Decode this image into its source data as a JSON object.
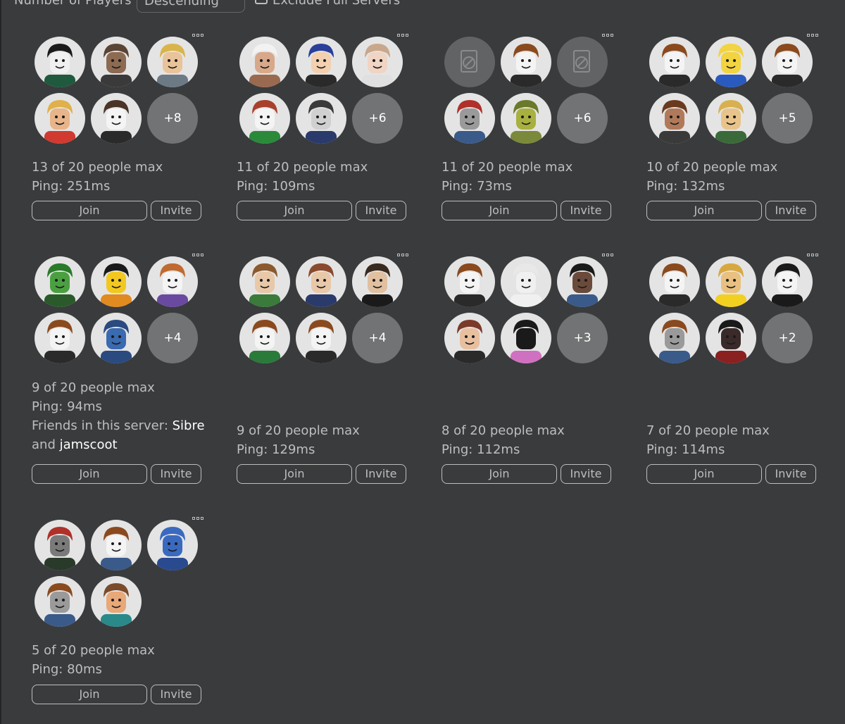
{
  "filters": {
    "sort_label": "Number of Players",
    "sort_value": "Descending",
    "exclude_full_label": "Exclude Full Servers",
    "exclude_full_checked": false
  },
  "buttons": {
    "join_label": "Join",
    "invite_label": "Invite"
  },
  "servers": [
    {
      "players_text": "13 of 20 people max",
      "ping_text": "Ping: 251ms",
      "avatars": [
        {
          "kind": "avatar",
          "icon": "avatar-black-hair-icon",
          "skin": "#f0f0f0",
          "hair": "#1a1a1a",
          "body": "#1f5a3e"
        },
        {
          "kind": "avatar",
          "icon": "avatar-bun-hair-icon",
          "skin": "#8d6a52",
          "hair": "#5a4436",
          "body": "#3a3a3a"
        },
        {
          "kind": "avatar",
          "icon": "avatar-blonde-sunglasses-icon",
          "skin": "#e9c39a",
          "hair": "#d9b44a",
          "body": "#6c7a86"
        }
      ],
      "avatars_row2": [
        {
          "kind": "avatar",
          "icon": "avatar-blonde-red-shirt-icon",
          "skin": "#e8b48a",
          "hair": "#e0b04a",
          "body": "#d03a30"
        },
        {
          "kind": "avatar",
          "icon": "avatar-smile-brown-hair-icon",
          "skin": "#f4f4f4",
          "hair": "#4a3428",
          "body": "#2a2a2a"
        }
      ],
      "overflow": "+8"
    },
    {
      "players_text": "11 of 20 people max",
      "ping_text": "Ping: 109ms",
      "avatars": [
        {
          "kind": "avatar",
          "icon": "avatar-white-cap-icon",
          "skin": "#d8a88a",
          "hair": "#f2f2f2",
          "body": "#9a6a50"
        },
        {
          "kind": "avatar",
          "icon": "avatar-blue-hair-icon",
          "skin": "#f2d0b0",
          "hair": "#2a3f9a",
          "body": "#2a2a2a"
        },
        {
          "kind": "avatar",
          "icon": "avatar-long-light-hair-icon",
          "skin": "#f0d4c4",
          "hair": "#c9a78a",
          "body": "#e0e0e0"
        }
      ],
      "avatars_row2": [
        {
          "kind": "avatar",
          "icon": "avatar-red-hair-icon",
          "skin": "#f4f4f4",
          "hair": "#a8402c",
          "body": "#2a8a3a"
        },
        {
          "kind": "avatar",
          "icon": "avatar-small-figure-icon",
          "skin": "#d0d0d0",
          "hair": "#3a3a3a",
          "body": "#2a3a6a"
        }
      ],
      "overflow": "+6"
    },
    {
      "players_text": "11 of 20 people max",
      "ping_text": "Ping: 73ms",
      "avatars": [
        {
          "kind": "blocked",
          "icon": "unavailable-avatar-icon"
        },
        {
          "kind": "avatar",
          "icon": "avatar-classic-brown-hair-icon",
          "skin": "#f4f4f4",
          "hair": "#8a4a1e",
          "body": "#2a2a2a"
        },
        {
          "kind": "blocked",
          "icon": "unavailable-avatar-icon"
        }
      ],
      "avatars_row2": [
        {
          "kind": "avatar",
          "icon": "avatar-red-cap-icon",
          "skin": "#9a9a9a",
          "hair": "#b0302a",
          "body": "#3a5a8a"
        },
        {
          "kind": "avatar",
          "icon": "avatar-green-creature-icon",
          "skin": "#a8b040",
          "hair": "#6a7a2a",
          "body": "#7a8a3a"
        }
      ],
      "overflow": "+6"
    },
    {
      "players_text": "10 of 20 people max",
      "ping_text": "Ping: 132ms",
      "avatars": [
        {
          "kind": "avatar",
          "icon": "avatar-classic-brown-hair-icon",
          "skin": "#f4f4f4",
          "hair": "#8a4a1e",
          "body": "#2a2a2a"
        },
        {
          "kind": "avatar",
          "icon": "avatar-yellow-noob-icon",
          "skin": "#f2d340",
          "hair": "#f2d340",
          "body": "#2a5ac0"
        },
        {
          "kind": "avatar",
          "icon": "avatar-classic-brown-hair-icon",
          "skin": "#f4f4f4",
          "hair": "#8a4a1e",
          "body": "#2a2a2a"
        }
      ],
      "avatars_row2": [
        {
          "kind": "avatar",
          "icon": "avatar-purple-sunglasses-icon",
          "skin": "#b07a5a",
          "hair": "#6a3a1e",
          "body": "#3a3a3a"
        },
        {
          "kind": "avatar",
          "icon": "avatar-blonde-green-shirt-icon",
          "skin": "#e8c48a",
          "hair": "#d8b050",
          "body": "#3a6a3a"
        }
      ],
      "overflow": "+5"
    },
    {
      "players_text": "9 of 20 people max",
      "ping_text": "Ping: 94ms",
      "friends_prefix": "Friends in this server:",
      "friend_1": "Sibre",
      "friends_and": "and",
      "friend_2": "jamscoot",
      "avatars": [
        {
          "kind": "avatar",
          "icon": "avatar-green-helmet-icon",
          "skin": "#4aa040",
          "hair": "#2a7a2a",
          "body": "#2a5a2a"
        },
        {
          "kind": "avatar",
          "icon": "avatar-duck-top-hat-icon",
          "skin": "#f2c820",
          "hair": "#1a1a1a",
          "body": "#e08a20"
        },
        {
          "kind": "avatar",
          "icon": "avatar-cowboy-hat-icon",
          "skin": "#f4f4f4",
          "hair": "#c06a30",
          "body": "#6a4aa0"
        }
      ],
      "avatars_row2": [
        {
          "kind": "avatar",
          "icon": "avatar-classic-brown-hair-icon",
          "skin": "#f4f4f4",
          "hair": "#8a4a1e",
          "body": "#2a2a2a"
        },
        {
          "kind": "avatar",
          "icon": "avatar-blue-face-icon",
          "skin": "#3a6ab0",
          "hair": "#2a4a80",
          "body": "#2a4a80"
        }
      ],
      "overflow": "+4"
    },
    {
      "players_text": "9 of 20 people max",
      "ping_text": "Ping: 129ms",
      "avatars": [
        {
          "kind": "avatar",
          "icon": "avatar-sunglasses-brown-hair-icon",
          "skin": "#e8c8a8",
          "hair": "#8a5a2e",
          "body": "#3a7a3a"
        },
        {
          "kind": "avatar",
          "icon": "avatar-glasses-brown-hair-icon",
          "skin": "#e8c8a8",
          "hair": "#8a4a2e",
          "body": "#2a3a6a"
        },
        {
          "kind": "avatar",
          "icon": "avatar-small-figure-icon",
          "skin": "#e0c0a0",
          "hair": "#3a2a1e",
          "body": "#1a1a1a"
        }
      ],
      "avatars_row2": [
        {
          "kind": "avatar",
          "icon": "avatar-classic-brown-hair-icon",
          "skin": "#f4f4f4",
          "hair": "#8a4a1e",
          "body": "#2a7a3a"
        },
        {
          "kind": "avatar",
          "icon": "avatar-classic-brown-hair-icon",
          "skin": "#f4f4f4",
          "hair": "#8a4a1e",
          "body": "#2a2a2a"
        }
      ],
      "overflow": "+4"
    },
    {
      "players_text": "8 of 20 people max",
      "ping_text": "Ping: 112ms",
      "avatars": [
        {
          "kind": "avatar",
          "icon": "avatar-classic-brown-hair-icon",
          "skin": "#f4f4f4",
          "hair": "#8a4a1e",
          "body": "#2a2a2a"
        },
        {
          "kind": "avatar",
          "icon": "avatar-small-figure-icon",
          "skin": "#f0f0f0",
          "hair": "#e8e8e8",
          "body": "#f0f0f0"
        },
        {
          "kind": "avatar",
          "icon": "avatar-dark-skin-icon",
          "skin": "#6a4a3a",
          "hair": "#1a1a1a",
          "body": "#3a5a8a"
        }
      ],
      "avatars_row2": [
        {
          "kind": "avatar",
          "icon": "avatar-long-red-hair-icon",
          "skin": "#e8c0a0",
          "hair": "#7a3a2a",
          "body": "#2a2a2a"
        },
        {
          "kind": "avatar",
          "icon": "avatar-small-figure-icon",
          "skin": "#1a1a1a",
          "hair": "#1a1a1a",
          "body": "#d070c0"
        }
      ],
      "overflow": "+3"
    },
    {
      "players_text": "7 of 20 people max",
      "ping_text": "Ping: 114ms",
      "avatars": [
        {
          "kind": "avatar",
          "icon": "avatar-classic-brown-hair-icon",
          "skin": "#f4f4f4",
          "hair": "#8a4a1e",
          "body": "#2a2a2a"
        },
        {
          "kind": "avatar",
          "icon": "avatar-blonde-yellow-shirt-icon",
          "skin": "#e8c080",
          "hair": "#d8a840",
          "body": "#f2d020"
        },
        {
          "kind": "avatar",
          "icon": "avatar-headphones-icon",
          "skin": "#f4f4f4",
          "hair": "#1a1a1a",
          "body": "#1a1a1a"
        }
      ],
      "avatars_row2": [
        {
          "kind": "avatar",
          "icon": "avatar-classic-brown-hair-icon",
          "skin": "#9a9a9a",
          "hair": "#8a4a1e",
          "body": "#3a5a8a"
        },
        {
          "kind": "avatar",
          "icon": "avatar-long-black-hair-icon",
          "skin": "#3a2a2a",
          "hair": "#1a1a1a",
          "body": "#8a2020"
        }
      ],
      "overflow": "+2"
    },
    {
      "players_text": "5 of 20 people max",
      "ping_text": "Ping: 80ms",
      "avatars": [
        {
          "kind": "avatar",
          "icon": "avatar-red-cap-sunglasses-icon",
          "skin": "#7a7a7a",
          "hair": "#b0302a",
          "body": "#2a3a2a"
        },
        {
          "kind": "avatar",
          "icon": "avatar-classic-brown-hair-icon",
          "skin": "#f4f4f4",
          "hair": "#8a4a1e",
          "body": "#3a5a8a"
        },
        {
          "kind": "avatar",
          "icon": "avatar-blue-bald-icon",
          "skin": "#3a6ac0",
          "hair": "#3a6ac0",
          "body": "#2a4a90"
        }
      ],
      "avatars_row2": [
        {
          "kind": "avatar",
          "icon": "avatar-classic-brown-hair-icon",
          "skin": "#9a9a9a",
          "hair": "#8a4a1e",
          "body": "#3a5a8a"
        },
        {
          "kind": "avatar",
          "icon": "avatar-angry-face-icon",
          "skin": "#e8a878",
          "hair": "#7a4a2a",
          "body": "#2a8a8a"
        }
      ],
      "overflow": ""
    }
  ]
}
